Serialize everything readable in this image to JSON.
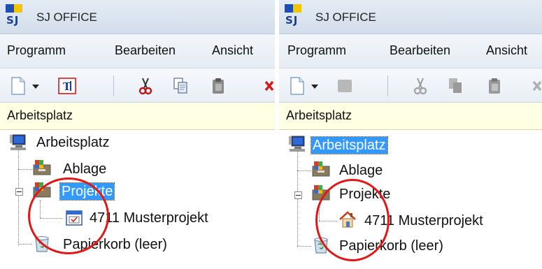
{
  "panels": [
    {
      "title": "SJ OFFICE",
      "logo_text": "SJ",
      "menu": [
        "Programm",
        "Bearbeiten",
        "Ansicht"
      ],
      "toolbar_icons": [
        "new-document-icon",
        "dropdown-arrow-icon",
        "text-field-icon",
        "cut-icon",
        "copy-icon",
        "paste-icon",
        "delete-icon"
      ],
      "pane_title": "Arbeitsplatz",
      "tree": [
        {
          "label": "Arbeitsplatz",
          "icon": "computer-icon",
          "selected": false
        },
        {
          "label": "Ablage",
          "icon": "drawer-icon",
          "selected": false
        },
        {
          "label": "Projekte",
          "icon": "projects-icon",
          "selected": true
        },
        {
          "label": "4711 Musterprojekt",
          "icon": "calendar-window-icon",
          "selected": false
        },
        {
          "label": "Papierkorb (leer)",
          "icon": "recycle-bin-icon",
          "selected": false
        }
      ]
    },
    {
      "title": "SJ OFFICE",
      "logo_text": "SJ",
      "menu": [
        "Programm",
        "Bearbeiten",
        "Ansicht"
      ],
      "toolbar_icons": [
        "new-document-icon",
        "dropdown-arrow-icon",
        "disabled-icon",
        "cut-icon",
        "copy-icon",
        "paste-icon"
      ],
      "pane_title": "Arbeitsplatz",
      "tree": [
        {
          "label": "Arbeitsplatz",
          "icon": "computer-icon",
          "selected": true
        },
        {
          "label": "Ablage",
          "icon": "drawer-icon",
          "selected": false
        },
        {
          "label": "Projekte",
          "icon": "projects-icon",
          "selected": false
        },
        {
          "label": "4711 Musterprojekt",
          "icon": "house-icon",
          "selected": false
        },
        {
          "label": "Papierkorb (leer)",
          "icon": "recycle-bin-icon",
          "selected": false
        }
      ]
    }
  ],
  "colors": {
    "selection": "#3399ff",
    "highlight_circle": "#e01818",
    "pane_header_bg": "#ffffe4"
  }
}
